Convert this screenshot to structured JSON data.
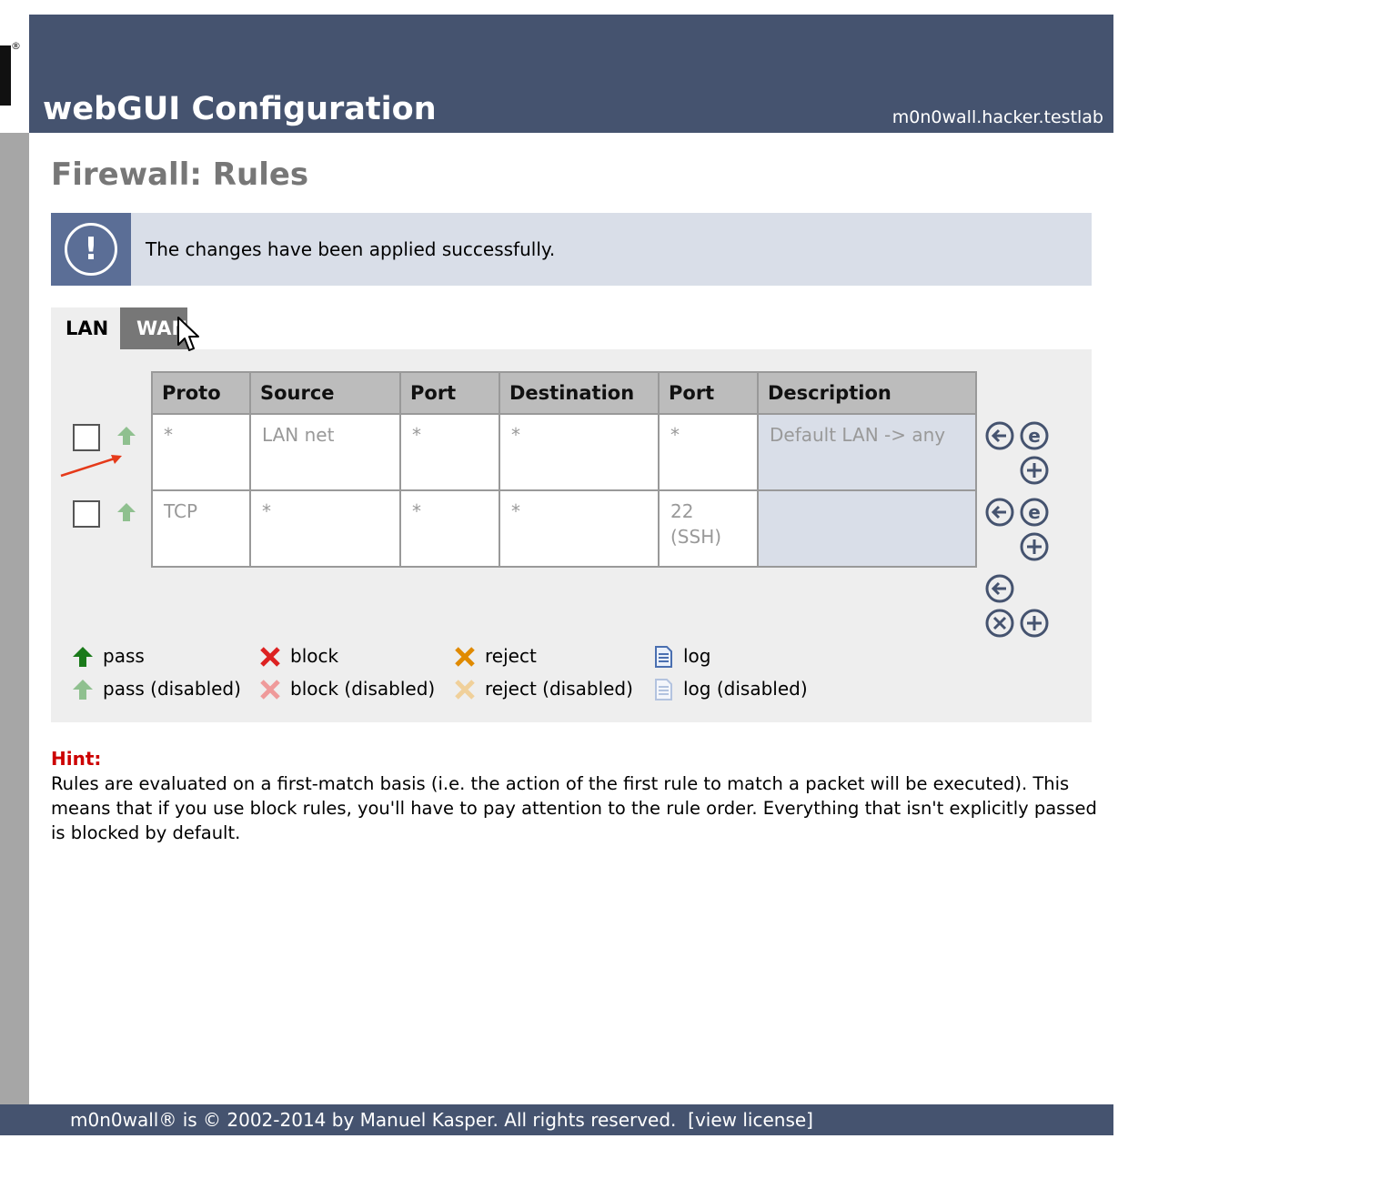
{
  "header": {
    "title": "webGUI Configuration",
    "hostname": "m0n0wall.hacker.testlab"
  },
  "page_title": "Firewall: Rules",
  "message": {
    "icon": "exclamation-icon",
    "text": "The changes have been applied successfully."
  },
  "tabs": [
    {
      "label": "LAN",
      "active": true
    },
    {
      "label": "WAN",
      "active": false
    }
  ],
  "table": {
    "columns": [
      "Proto",
      "Source",
      "Port",
      "Destination",
      "Port",
      "Description"
    ],
    "rows": [
      {
        "action": "pass (disabled)",
        "proto": "*",
        "source": "LAN net",
        "src_port": "*",
        "destination": "*",
        "dst_port": "*",
        "description": "Default LAN -> any"
      },
      {
        "action": "pass (disabled)",
        "proto": "TCP",
        "source": "*",
        "src_port": "*",
        "destination": "*",
        "dst_port": "22 (SSH)",
        "description": ""
      }
    ]
  },
  "legend": {
    "pass": "pass",
    "pass_disabled": "pass (disabled)",
    "block": "block",
    "block_disabled": "block (disabled)",
    "reject": "reject",
    "reject_disabled": "reject (disabled)",
    "log": "log",
    "log_disabled": "log (disabled)"
  },
  "hint": {
    "title": "Hint:",
    "text": "Rules are evaluated on a first-match basis (i.e. the action of the first rule to match a packet will be executed). This means that if you use block rules, you'll have to pay attention to the rule order. Everything that isn't explicitly passed is blocked by default."
  },
  "footer": {
    "copyright": "m0n0wall® is © 2002-2014 by Manuel Kasper. All rights reserved.",
    "license_link": "[view license]"
  },
  "colors": {
    "header_bg": "#45536f",
    "pass": "#1a7a1a",
    "pass_disabled": "#8fc08f",
    "block": "#dd2222",
    "reject": "#e08a00",
    "hint": "#cc0000"
  }
}
